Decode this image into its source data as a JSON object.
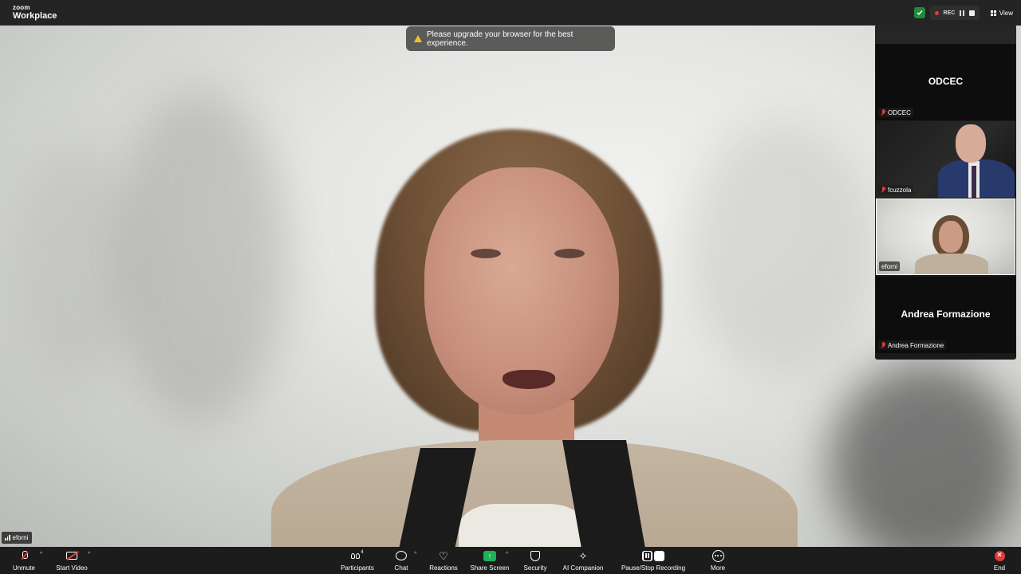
{
  "app": {
    "logo_top": "zoom",
    "logo_bottom": "Workplace"
  },
  "topbar": {
    "rec_label": "REC",
    "view_label": "View"
  },
  "notification": {
    "text": "Please upgrade your browser for the best experience."
  },
  "gallery": {
    "tiles": [
      {
        "display_name": "ODCEC",
        "label": "ODCEC",
        "muted": true,
        "video": false
      },
      {
        "display_name": "",
        "label": "fcuzzola",
        "muted": true,
        "video": true
      },
      {
        "display_name": "",
        "label": "eforni",
        "muted": false,
        "video": true
      },
      {
        "display_name": "Andrea Formazione",
        "label": "Andrea Formazione",
        "muted": true,
        "video": false
      }
    ]
  },
  "self_view": {
    "name": "eforni"
  },
  "toolbar": {
    "unmute": "Unmute",
    "start_video": "Start Video",
    "participants": "Participants",
    "participants_count": "4",
    "chat": "Chat",
    "reactions": "Reactions",
    "share_screen": "Share Screen",
    "security": "Security",
    "ai_companion": "AI Companion",
    "pause_stop_recording": "Pause/Stop Recording",
    "more": "More",
    "end": "End"
  },
  "colors": {
    "accent_green": "#1fb159",
    "danger_red": "#e03c3c",
    "toolbar_bg": "#1c1c1c"
  }
}
